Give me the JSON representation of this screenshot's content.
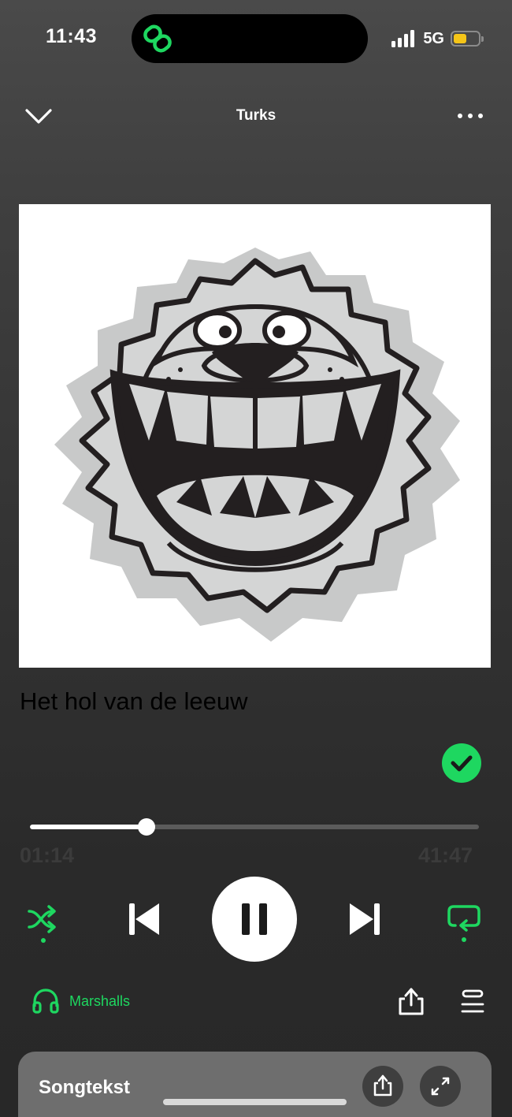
{
  "status_bar": {
    "time": "11:43",
    "network": "5G",
    "signal_bars": 4,
    "battery_color": "#f5c518",
    "island_icon": "link-icon"
  },
  "header": {
    "title": "Turks",
    "left_icon": "chevron-down-icon",
    "right_icon": "more-icon"
  },
  "album_art": {
    "description_icon": "lion-face-icon"
  },
  "track": {
    "title": "Het hol van de leeuw",
    "saved": true
  },
  "playback": {
    "elapsed": "01:14",
    "total": "41:47",
    "progress": 0.26,
    "is_playing": true,
    "shuffle_on": true,
    "repeat_on": true
  },
  "device": {
    "name": "Marshalls",
    "icon": "headphones-icon"
  },
  "lyrics": {
    "title": "Songtekst"
  },
  "colors": {
    "accent": "#1ed760",
    "background": "#2b2b2b",
    "lyrics_card": "#6e6e6e"
  }
}
